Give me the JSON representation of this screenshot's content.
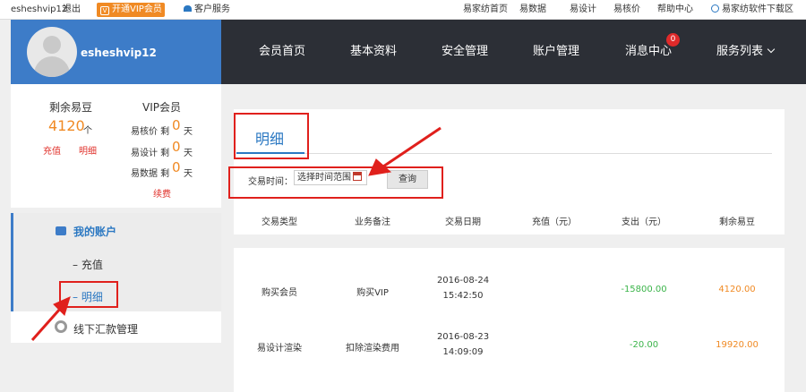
{
  "topbar": {
    "username": "esheshvip12",
    "logout": "退出",
    "vip_button": "开通VIP会员",
    "customer_service": "客户服务",
    "links": [
      "易家纺首页",
      "易数据",
      "易设计",
      "易核价",
      "帮助中心"
    ],
    "download": "易家纺软件下载区"
  },
  "user": {
    "name": "esheshvip12"
  },
  "nav": {
    "items": [
      "会员首页",
      "基本资料",
      "安全管理",
      "账户管理",
      "消息中心",
      "服务列表"
    ],
    "message_badge": "0"
  },
  "beans": {
    "title": "剩余易豆",
    "value": "4120",
    "unit": "个",
    "recharge": "充值",
    "detail": "明细"
  },
  "vip": {
    "title": "VIP会员",
    "rows": [
      {
        "label": "易核价 剩",
        "days": "0",
        "unit": "天"
      },
      {
        "label": "易设计 剩",
        "days": "0",
        "unit": "天"
      },
      {
        "label": "易数据 剩",
        "days": "0",
        "unit": "天"
      }
    ],
    "renew": "续费"
  },
  "menu": {
    "my_account": "我的账户",
    "recharge": "– 充值",
    "detail": "– 明细",
    "offline": "线下汇款管理"
  },
  "main": {
    "tab_title": "明细",
    "filter_label": "交易时间：",
    "date_placeholder": "选择时间范围",
    "query_button": "查询",
    "headers": [
      "交易类型",
      "业务备注",
      "交易日期",
      "充值（元）",
      "支出（元）",
      "剩余易豆"
    ],
    "rows": [
      {
        "type": "购买会员",
        "note": "购买VIP",
        "date": "2016-08-24",
        "time": "15:42:50",
        "recharge": "",
        "expense": "-15800.00",
        "balance": "4120.00"
      },
      {
        "type": "易设计渲染",
        "note": "扣除渲染费用",
        "date": "2016-08-23",
        "time": "14:09:09",
        "recharge": "",
        "expense": "-20.00",
        "balance": "19920.00"
      }
    ]
  },
  "colors": {
    "accent": "#3d7cc8",
    "nav_bg": "#2c2f36",
    "orange": "#f08a24",
    "annotation_red": "#e0201c",
    "expense_green": "#3bb44a"
  }
}
